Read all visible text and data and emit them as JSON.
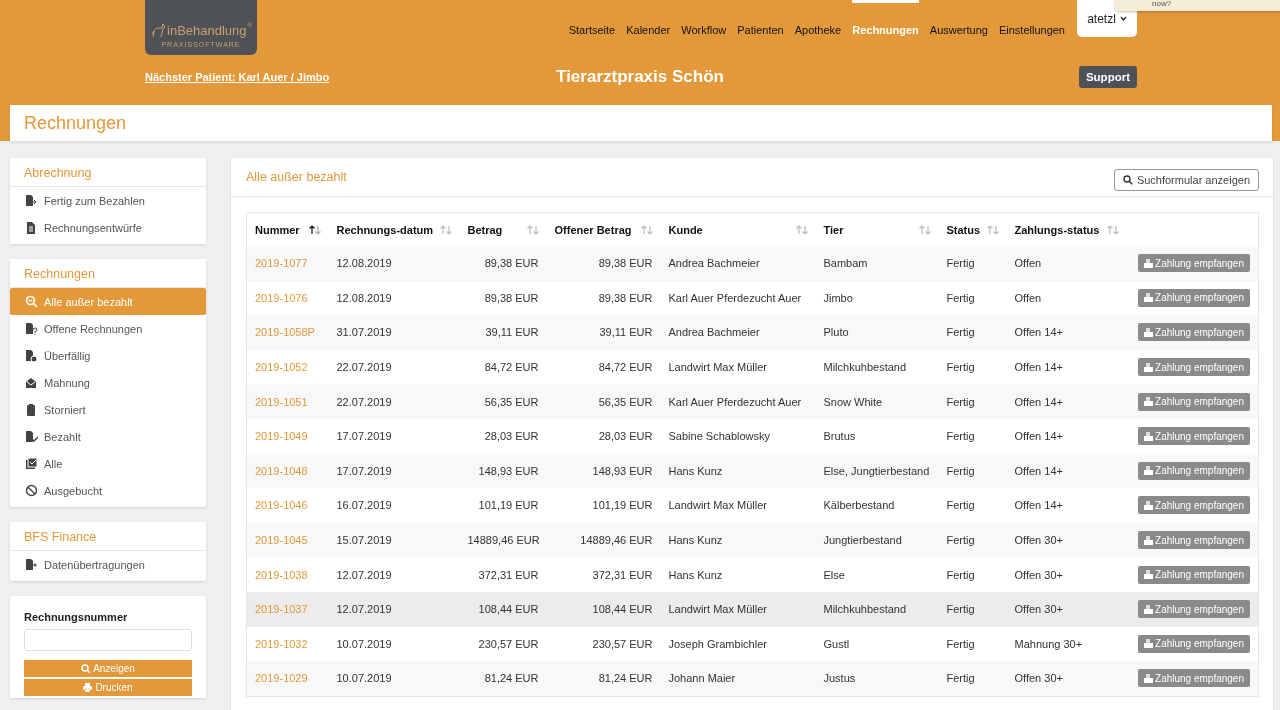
{
  "notification": {
    "text": "now?"
  },
  "header": {
    "logo": {
      "name": "inBehandlung",
      "mark": "®",
      "tagline": "PRAXISSOFTWARE"
    },
    "nav": [
      {
        "label": "Startseite",
        "selected": false
      },
      {
        "label": "Kalender",
        "selected": false
      },
      {
        "label": "Workflow",
        "selected": false
      },
      {
        "label": "Patienten",
        "selected": false
      },
      {
        "label": "Apotheke",
        "selected": false
      },
      {
        "label": "Rechnungen",
        "selected": true
      },
      {
        "label": "Auswertung",
        "selected": false
      },
      {
        "label": "Einstellungen",
        "selected": false
      }
    ],
    "user": {
      "name": "atetzl"
    },
    "next_patient": "Nächster Patient: Karl Auer / Jimbo",
    "practice_name": "Tierarztpraxis Schön",
    "support_button": "Support"
  },
  "page_title": "Rechnungen",
  "sidebar": {
    "sections": [
      {
        "title": "Abrechnung",
        "items": [
          {
            "label": "Fertig zum Bezahlen",
            "selected": false
          },
          {
            "label": "Rechnungsentwürfe",
            "selected": false
          }
        ]
      },
      {
        "title": "Rechnungen",
        "items": [
          {
            "label": "Alle außer bezahlt",
            "selected": true
          },
          {
            "label": "Offene Rechnungen",
            "selected": false
          },
          {
            "label": "Überfällig",
            "selected": false
          },
          {
            "label": "Mahnung",
            "selected": false
          },
          {
            "label": "Storniert",
            "selected": false
          },
          {
            "label": "Bezahlt",
            "selected": false
          },
          {
            "label": "Alle",
            "selected": false
          },
          {
            "label": "Ausgebucht",
            "selected": false
          }
        ]
      },
      {
        "title": "BFS Finance",
        "items": [
          {
            "label": "Datenübertragungen",
            "selected": false
          }
        ]
      }
    ],
    "search": {
      "label": "Rechnungsnummer",
      "buttons": [
        "Anzeigen",
        "Drucken"
      ]
    }
  },
  "main": {
    "title": "Alle außer bezahlt",
    "search_button": "Suchformular anzeigen",
    "table": {
      "columns": [
        {
          "label": "Nummer",
          "sorted": true
        },
        {
          "label": "Rechnungs-datum",
          "sorted": false
        },
        {
          "label": "Betrag",
          "sorted": false
        },
        {
          "label": "Offener Betrag",
          "sorted": false
        },
        {
          "label": "Kunde",
          "sorted": false
        },
        {
          "label": "Tier",
          "sorted": false
        },
        {
          "label": "Status",
          "sorted": false
        },
        {
          "label": "Zahlungs-status",
          "sorted": false
        }
      ],
      "rows": [
        {
          "cells": [
            "2019-1077",
            "12.08.2019",
            "89,38 EUR",
            "89,38 EUR",
            "Andrea Bachmeier",
            "Bambam",
            "Fertig",
            "Offen"
          ],
          "action": "Zahlung empfangen",
          "highlighted": false
        },
        {
          "cells": [
            "2019-1076",
            "12.08.2019",
            "89,38 EUR",
            "89,38 EUR",
            "Karl Auer Pferdezucht Auer",
            "Jimbo",
            "Fertig",
            "Offen"
          ],
          "action": "Zahlung empfangen",
          "highlighted": false
        },
        {
          "cells": [
            "2019-1058P",
            "31.07.2019",
            "39,11 EUR",
            "39,11 EUR",
            "Andrea Bachmeier",
            "Pluto",
            "Fertig",
            "Offen 14+"
          ],
          "action": "Zahlung empfangen",
          "highlighted": false
        },
        {
          "cells": [
            "2019-1052",
            "22.07.2019",
            "84,72 EUR",
            "84,72 EUR",
            "Landwirt Max Müller",
            "Milchkuhbestand",
            "Fertig",
            "Offen 14+"
          ],
          "action": "Zahlung empfangen",
          "highlighted": false
        },
        {
          "cells": [
            "2019-1051",
            "22.07.2019",
            "56,35 EUR",
            "56,35 EUR",
            "Karl Auer Pferdezucht Auer",
            "Snow White",
            "Fertig",
            "Offen 14+"
          ],
          "action": "Zahlung empfangen",
          "highlighted": false
        },
        {
          "cells": [
            "2019-1049",
            "17.07.2019",
            "28,03 EUR",
            "28,03 EUR",
            "Sabine Schablowsky",
            "Brutus",
            "Fertig",
            "Offen 14+"
          ],
          "action": "Zahlung empfangen",
          "highlighted": false
        },
        {
          "cells": [
            "2019-1048",
            "17.07.2019",
            "148,93 EUR",
            "148,93 EUR",
            "Hans Kunz",
            "Else, Jungtierbestand",
            "Fertig",
            "Offen 14+"
          ],
          "action": "Zahlung empfangen",
          "highlighted": false
        },
        {
          "cells": [
            "2019-1046",
            "16.07.2019",
            "101,19 EUR",
            "101,19 EUR",
            "Landwirt Max Müller",
            "Kälberbestand",
            "Fertig",
            "Offen 14+"
          ],
          "action": "Zahlung empfangen",
          "highlighted": false
        },
        {
          "cells": [
            "2019-1045",
            "15.07.2019",
            "14889,46 EUR",
            "14889,46 EUR",
            "Hans Kunz",
            "Jungtierbestand",
            "Fertig",
            "Offen 30+"
          ],
          "action": "Zahlung empfangen",
          "highlighted": false
        },
        {
          "cells": [
            "2019-1038",
            "12.07.2019",
            "372,31 EUR",
            "372,31 EUR",
            "Hans Kunz",
            "Else",
            "Fertig",
            "Offen 30+"
          ],
          "action": "Zahlung empfangen",
          "highlighted": false
        },
        {
          "cells": [
            "2019-1037",
            "12.07.2019",
            "108,44 EUR",
            "108,44 EUR",
            "Landwirt Max Müller",
            "Milchkuhbestand",
            "Fertig",
            "Offen 30+"
          ],
          "action": "Zahlung empfangen",
          "highlighted": true
        },
        {
          "cells": [
            "2019-1032",
            "10.07.2019",
            "230,57 EUR",
            "230,57 EUR",
            "Joseph Grambichler",
            "Gustl",
            "Fertig",
            "Mahnung 30+"
          ],
          "action": "Zahlung empfangen",
          "highlighted": false
        },
        {
          "cells": [
            "2019-1029",
            "10.07.2019",
            "81,24 EUR",
            "81,24 EUR",
            "Johann Maier",
            "Justus",
            "Fertig",
            "Offen 30+"
          ],
          "action": "Zahlung empfangen",
          "highlighted": false
        }
      ]
    }
  }
}
